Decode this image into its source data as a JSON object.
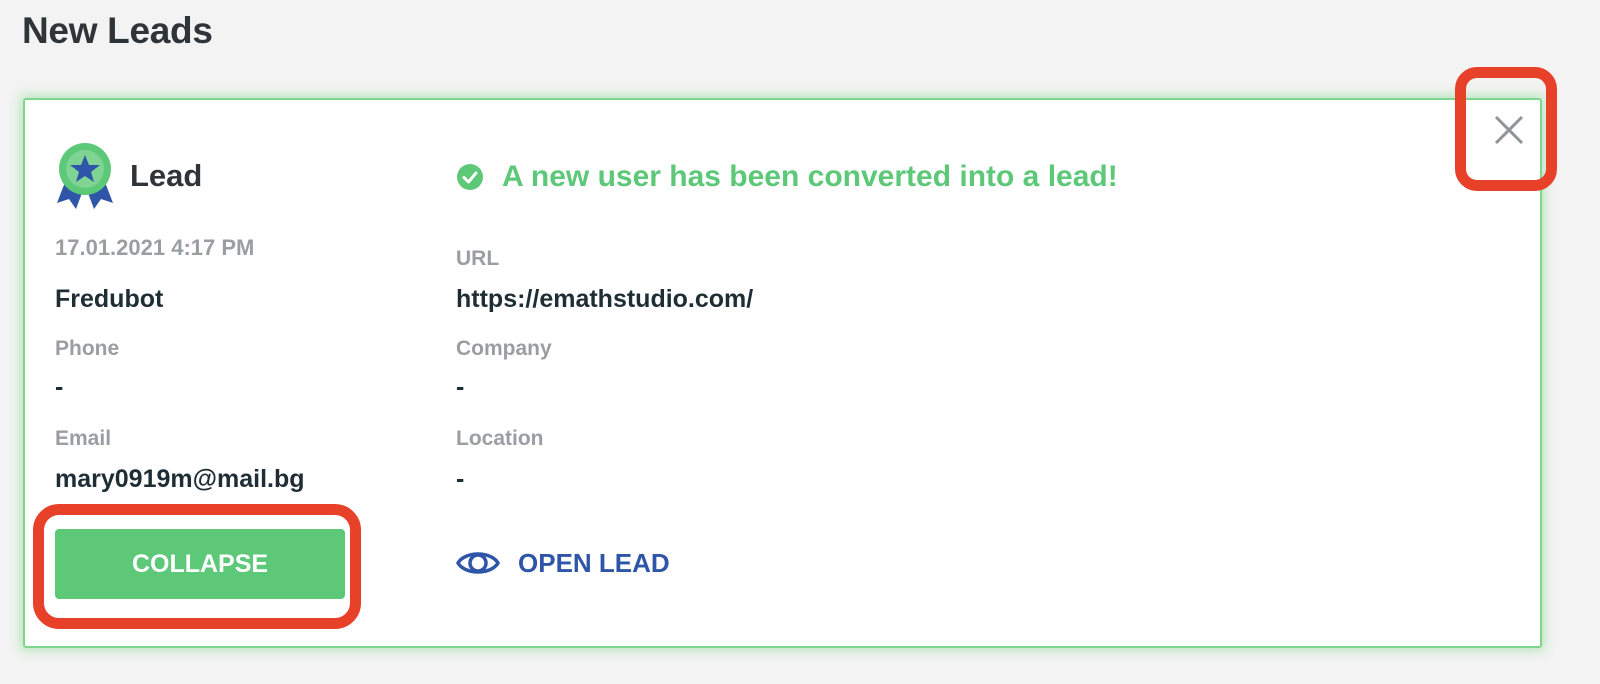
{
  "page": {
    "title": "New Leads"
  },
  "card": {
    "type_label": "Lead",
    "banner": "A new user has been converted into a lead!",
    "datetime": "17.01.2021 4:17 PM",
    "name": "Fredubot",
    "fields": {
      "phone": {
        "label": "Phone",
        "value": "-"
      },
      "email": {
        "label": "Email",
        "value": "mary0919m@mail.bg"
      },
      "url": {
        "label": "URL",
        "value": "https://emathstudio.com/"
      },
      "company": {
        "label": "Company",
        "value": "-"
      },
      "location": {
        "label": "Location",
        "value": "-"
      }
    },
    "actions": {
      "collapse_label": "COLLAPSE",
      "open_lead_label": "OPEN LEAD"
    }
  },
  "icons": {
    "badge": "award-ribbon-icon",
    "check": "check-circle-icon",
    "eye": "eye-icon",
    "close": "close-icon"
  },
  "colors": {
    "accent_green": "#5ec879",
    "link_blue": "#2f55a8",
    "highlight_red": "#e8412a"
  }
}
